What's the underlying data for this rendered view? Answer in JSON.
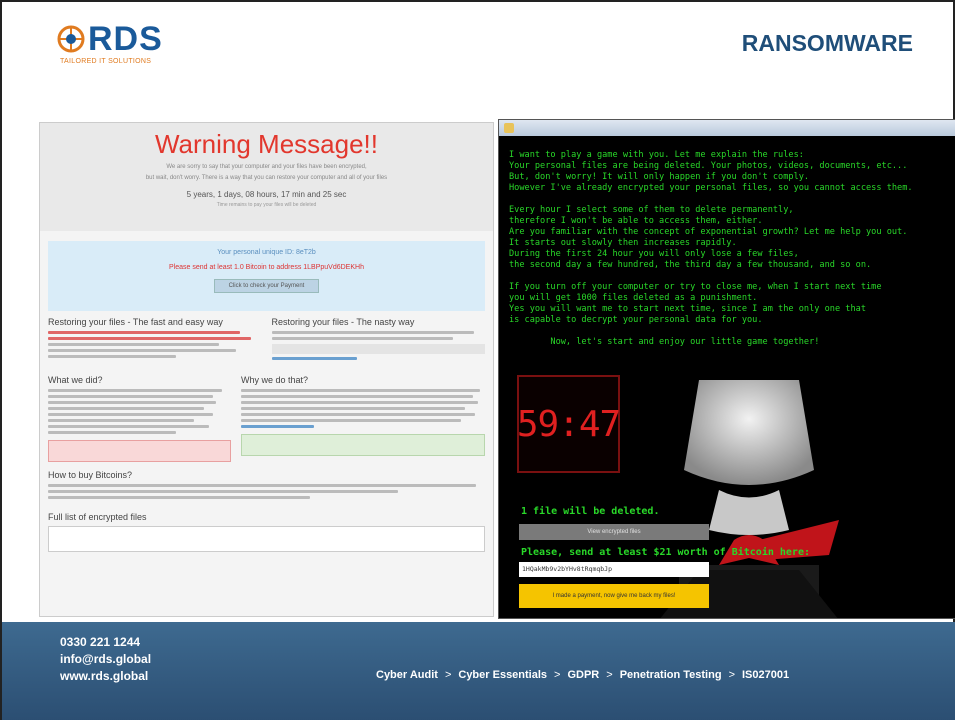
{
  "header": {
    "logo_text": "RDS",
    "logo_tagline": "TAILORED IT SOLUTIONS",
    "title": "RANSOMWARE"
  },
  "left_screenshot": {
    "warning_title": "Warning Message!!",
    "lead_line_1": "We are sorry to say that your computer and your files have been encrypted,",
    "lead_line_2": "but wait, don't worry. There is a way that you can restore your computer and all of your files",
    "countdown": "5 years, 1 days, 08 hours, 17 min and 25 sec",
    "countdown_note": "Time remains to pay your files will be deleted",
    "unique_id_line": "Your personal unique ID: 8eT2b",
    "send_line": "Please send at least 1.0 Bitcoin to address 1LBPpuVd6DEKHh",
    "check_button": "Click to check your Payment",
    "sections": {
      "fast_way": "Restoring your files - The fast and easy way",
      "nasty_way": "Restoring your files - The nasty way",
      "what_we_did": "What we did?",
      "why_we_did": "Why we do that?",
      "how_to_buy": "How to buy Bitcoins?",
      "encrypted_list": "Full list of encrypted files"
    }
  },
  "right_screenshot": {
    "game_text": "I want to play a game with you. Let me explain the rules:\nYour personal files are being deleted. Your photos, videos, documents, etc...\nBut, don't worry! It will only happen if you don't comply.\nHowever I've already encrypted your personal files, so you cannot access them.\n\nEvery hour I select some of them to delete permanently,\ntherefore I won't be able to access them, either.\nAre you familiar with the concept of exponential growth? Let me help you out.\nIt starts out slowly then increases rapidly.\nDuring the first 24 hour you will only lose a few files,\nthe second day a few hundred, the third day a few thousand, and so on.\n\nIf you turn off your computer or try to close me, when I start next time\nyou will get 1000 files deleted as a punishment.\nYes you will want me to start next time, since I am the only one that\nis capable to decrypt your personal data for you.\n\n        Now, let's start and enjoy our little game together!",
    "timer": "59:47",
    "files_deleted": "1 file will be deleted.",
    "view_button": "View encrypted files",
    "send_prompt": "Please, send at least $21 worth of Bitcoin here:",
    "bitcoin_address": "1HQakMb9v2bYHv8tRqmqbJp",
    "pay_button": "I made a payment, now give me back my files!"
  },
  "footer": {
    "phone": "0330 221 1244",
    "email": "info@rds.global",
    "website": "www.rds.global",
    "services": [
      "Cyber Audit",
      "Cyber Essentials",
      "GDPR",
      "Penetration Testing",
      "IS027001"
    ],
    "separator": ">"
  },
  "colors": {
    "title_blue": "#1f4e79",
    "warning_red": "#e2372d",
    "terminal_green": "#29d829",
    "footer_blue": "#34597d",
    "pay_yellow": "#f5c400"
  }
}
